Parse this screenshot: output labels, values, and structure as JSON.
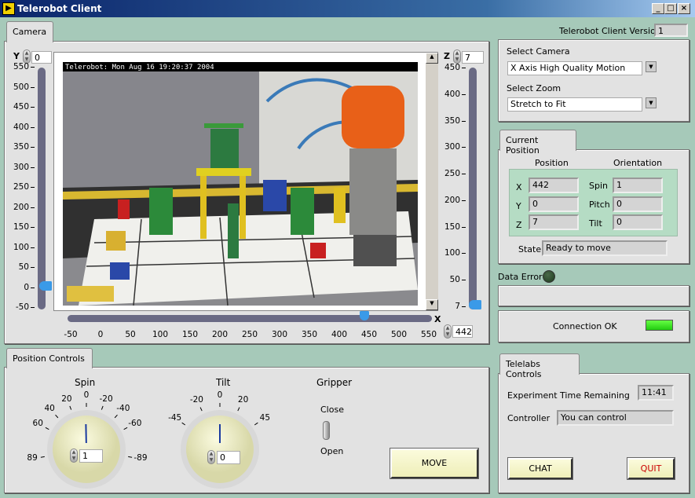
{
  "window": {
    "title": "Telerobot Client",
    "icon": "labview-icon",
    "controls": [
      "minimize",
      "maximize",
      "close"
    ]
  },
  "camera_tab": {
    "label": "Camera",
    "overlay_text": "Telerobot: Mon Aug 16 19:20:37 2004",
    "y_axis": {
      "label": "Y",
      "value": "0",
      "ticks": [
        "550",
        "500",
        "450",
        "400",
        "350",
        "300",
        "250",
        "200",
        "150",
        "100",
        "50",
        "0",
        "-50"
      ],
      "level": 0
    },
    "z_axis": {
      "label": "Z",
      "value": "7",
      "ticks": [
        "450",
        "400",
        "350",
        "300",
        "250",
        "200",
        "150",
        "100",
        "50",
        "7"
      ],
      "level": 7
    },
    "x_axis": {
      "label": "X",
      "value": "442",
      "ticks": [
        "-50",
        "0",
        "50",
        "100",
        "150",
        "200",
        "250",
        "300",
        "350",
        "400",
        "450",
        "500",
        "550"
      ],
      "level": 442
    }
  },
  "version": {
    "label": "Telerobot Client Version",
    "value": "1"
  },
  "select_panel": {
    "camera_label": "Select Camera",
    "camera_value": "X Axis High Quality Motion",
    "zoom_label": "Select Zoom",
    "zoom_value": "Stretch to Fit"
  },
  "current_position": {
    "tab_label": "Current Position",
    "position_header": "Position",
    "orientation_header": "Orientation",
    "x_label": "X",
    "x": "442",
    "y_label": "Y",
    "y": "0",
    "z_label": "Z",
    "z": "7",
    "spin_label": "Spin",
    "spin": "1",
    "pitch_label": "Pitch",
    "pitch": "0",
    "tilt_label": "Tilt",
    "tilt": "0",
    "state_label": "State",
    "state": "Ready to move"
  },
  "data_error": {
    "label": "Data Error",
    "led": "off",
    "color": "#1e3a1e"
  },
  "connection": {
    "label": "Connection OK",
    "led": "on",
    "color": "#33dd22"
  },
  "telelabs": {
    "tab_label": "Telelabs Controls",
    "time_label": "Experiment Time Remaining",
    "time": "11:41",
    "controller_label": "Controller",
    "controller": "You can control",
    "chat": "CHAT",
    "quit": "QUIT",
    "quit_color": "#cc0000"
  },
  "position_controls": {
    "tab_label": "Position Controls",
    "spin": {
      "label": "Spin",
      "value": "1",
      "ticks": [
        "89",
        "60",
        "40",
        "20",
        "0",
        "-20",
        "-40",
        "-60",
        "-89"
      ]
    },
    "tilt": {
      "label": "Tilt",
      "value": "0",
      "ticks": [
        "-45",
        "-20",
        "0",
        "20",
        "45"
      ]
    },
    "gripper": {
      "label": "Gripper",
      "close": "Close",
      "open": "Open",
      "state": "open"
    },
    "move": "MOVE"
  }
}
